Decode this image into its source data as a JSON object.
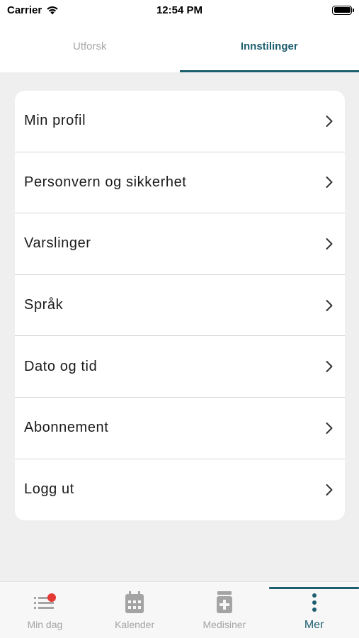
{
  "status_bar": {
    "carrier": "Carrier",
    "time": "12:54 PM"
  },
  "top_tabs": [
    {
      "label": "Utforsk",
      "active": false
    },
    {
      "label": "Innstilinger",
      "active": true
    }
  ],
  "settings": {
    "items": [
      {
        "label": "Min profil"
      },
      {
        "label": "Personvern og sikkerhet"
      },
      {
        "label": "Varslinger"
      },
      {
        "label": "Språk"
      },
      {
        "label": "Dato og tid"
      },
      {
        "label": "Abonnement"
      },
      {
        "label": "Logg ut"
      }
    ]
  },
  "bottom_nav": {
    "items": [
      {
        "label": "Min dag",
        "icon": "list-icon",
        "active": false,
        "badge": true
      },
      {
        "label": "Kalender",
        "icon": "calendar-icon",
        "active": false
      },
      {
        "label": "Medisiner",
        "icon": "medicine-icon",
        "active": false
      },
      {
        "label": "Mer",
        "icon": "more-vertical-icon",
        "active": true
      }
    ]
  },
  "colors": {
    "accent": "#1d5f6f",
    "badge": "#e53935",
    "inactive": "#a4a4a4",
    "background": "#efefef"
  }
}
